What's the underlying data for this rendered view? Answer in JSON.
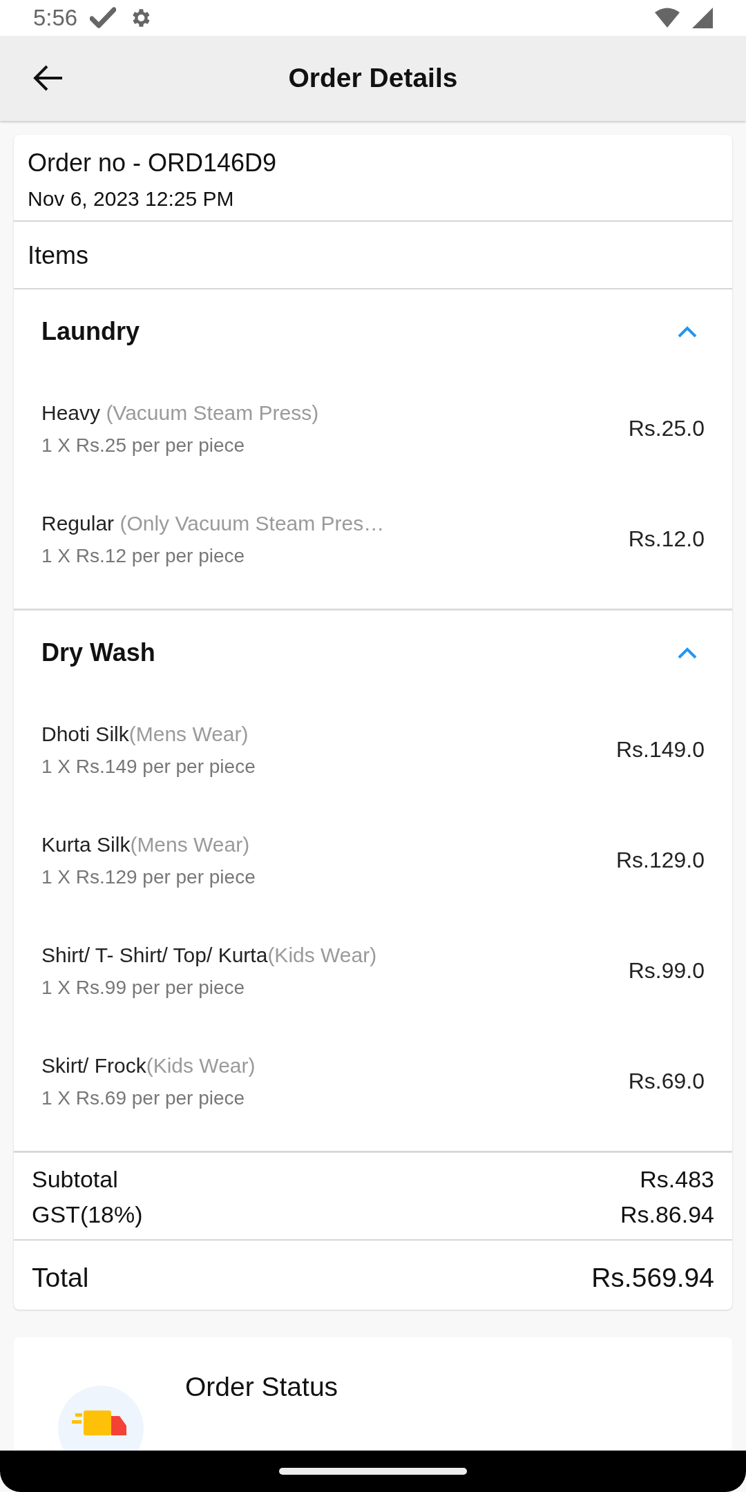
{
  "status_bar": {
    "time": "5:56"
  },
  "app_bar": {
    "title": "Order Details"
  },
  "order": {
    "number": "Order no - ORD146D9",
    "date": "Nov 6, 2023 12:25 PM"
  },
  "items_heading": "Items",
  "groups": [
    {
      "name": "Laundry",
      "expanded": true,
      "items": [
        {
          "name": "Heavy",
          "detail": " (Vacuum Steam Press)",
          "quantity": "1 X Rs.25 per per piece",
          "price": "Rs.25.0"
        },
        {
          "name": "Regular",
          "detail": " (Only Vacuum Steam Pres…",
          "quantity": "1 X Rs.12 per per piece",
          "price": "Rs.12.0"
        }
      ]
    },
    {
      "name": "Dry Wash",
      "expanded": true,
      "items": [
        {
          "name": "Dhoti Silk",
          "detail": "(Mens Wear)",
          "quantity": "1 X Rs.149 per per piece",
          "price": "Rs.149.0"
        },
        {
          "name": "Kurta Silk",
          "detail": "(Mens Wear)",
          "quantity": "1 X Rs.129 per per piece",
          "price": "Rs.129.0"
        },
        {
          "name": "Shirt/ T- Shirt/ Top/ Kurta",
          "detail": "(Kids Wear)",
          "quantity": "1 X Rs.99 per per piece",
          "price": "Rs.99.0"
        },
        {
          "name": "Skirt/ Frock",
          "detail": "(Kids Wear)",
          "quantity": "1 X Rs.69 per per piece",
          "price": "Rs.69.0"
        }
      ]
    }
  ],
  "summary": [
    {
      "label": "Subtotal",
      "value": "Rs.483"
    },
    {
      "label": "GST(18%)",
      "value": "Rs.86.94"
    }
  ],
  "total": {
    "label": "Total",
    "value": "Rs.569.94"
  },
  "status_card": {
    "title": "Order Status"
  }
}
